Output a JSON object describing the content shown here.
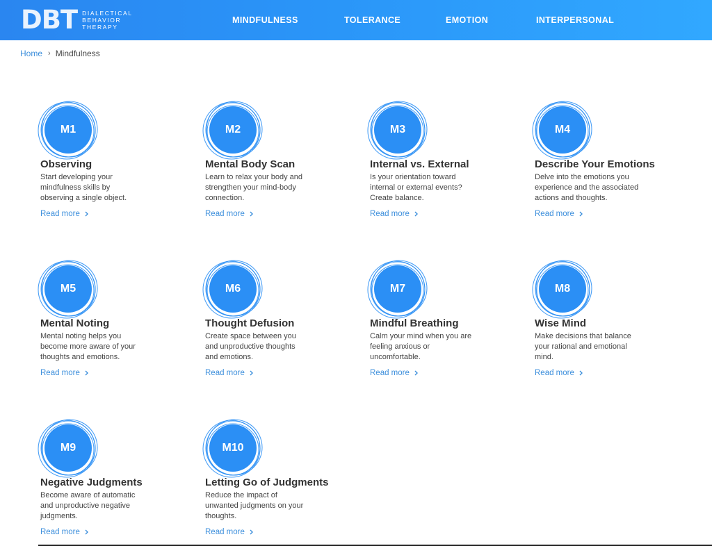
{
  "header": {
    "logo_mark": "DBT",
    "logo_lines": [
      "DIALECTICAL",
      "BEHAVIOR",
      "THERAPY"
    ],
    "nav": [
      "MINDFULNESS",
      "TOLERANCE",
      "EMOTION",
      "INTERPERSONAL"
    ]
  },
  "breadcrumb": {
    "home": "Home",
    "current": "Mindfulness"
  },
  "read_more_label": "Read more",
  "modules": [
    {
      "code": "M1",
      "title": "Observing",
      "description": "Start developing your mindfulness skills by observing a single object."
    },
    {
      "code": "M2",
      "title": "Mental Body Scan",
      "description": "Learn to relax your body and strengthen your mind-body connection."
    },
    {
      "code": "M3",
      "title": "Internal vs. External",
      "description": "Is your orientation toward internal or external events? Create balance."
    },
    {
      "code": "M4",
      "title": "Describe Your Emotions",
      "description": "Delve into the emotions you experience and the associated actions and thoughts."
    },
    {
      "code": "M5",
      "title": "Mental Noting",
      "description": "Mental noting helps you become more aware of your thoughts and emotions."
    },
    {
      "code": "M6",
      "title": "Thought Defusion",
      "description": "Create space between you and unproductive thoughts and emotions."
    },
    {
      "code": "M7",
      "title": "Mindful Breathing",
      "description": "Calm your mind when you are feeling anxious or uncomfortable."
    },
    {
      "code": "M8",
      "title": "Wise Mind",
      "description": "Make decisions that balance your rational and emotional mind."
    },
    {
      "code": "M9",
      "title": "Negative Judgments",
      "description": "Become aware of automatic and unproductive negative judgments."
    },
    {
      "code": "M10",
      "title": "Letting Go of Judgments",
      "description": "Reduce the impact of unwanted judgments on your thoughts."
    }
  ],
  "colors": {
    "header_start": "#2a86f0",
    "header_end": "#31a8ff",
    "badge_fill": "#2b8ff5",
    "link": "#3d8fdc"
  }
}
